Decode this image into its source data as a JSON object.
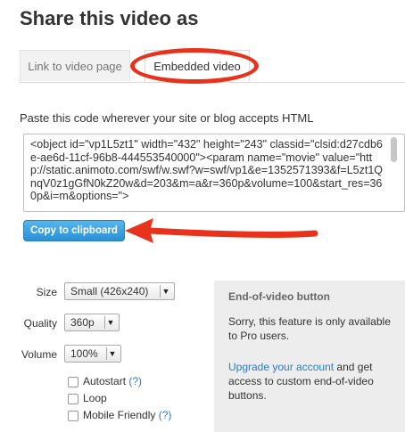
{
  "header": {
    "title": "Share this video as"
  },
  "tabs": [
    {
      "label": "Link to video page"
    },
    {
      "label": "Embedded video"
    }
  ],
  "embed": {
    "instructions": "Paste this code wherever your site or blog accepts HTML",
    "code": "<object id=\"vp1L5zt1\" width=\"432\" height=\"243\" classid=\"clsid:d27cdb6e-ae6d-11cf-96b8-444553540000\"><param name=\"movie\" value=\"http://static.animoto.com/swf/w.swf?w=swf/vp1&e=1352571393&f=L5zt1QnqV0z1gGfN0kZ20w&d=203&m=a&r=360p&volume=100&start_res=360p&i=m&options=\">",
    "copy_label": "Copy to clipboard"
  },
  "options": {
    "size": {
      "label": "Size",
      "value": "Small (426x240)"
    },
    "quality": {
      "label": "Quality",
      "value": "360p"
    },
    "volume": {
      "label": "Volume",
      "value": "100%"
    },
    "checkboxes": [
      {
        "label": "Autostart",
        "help": "(?)",
        "checked": false
      },
      {
        "label": "Loop",
        "help": "",
        "checked": false
      },
      {
        "label": "Mobile Friendly",
        "help": "(?)",
        "checked": false
      }
    ]
  },
  "end_video": {
    "title": "End-of-video button",
    "message": "Sorry, this feature is only available to Pro users.",
    "upgrade_link": "Upgrade your account",
    "upgrade_rest": " and get access to custom end-of-video buttons."
  },
  "colors": {
    "accent": "#2a8fd3",
    "annotation": "#e8321c",
    "link": "#2a7cc7"
  }
}
